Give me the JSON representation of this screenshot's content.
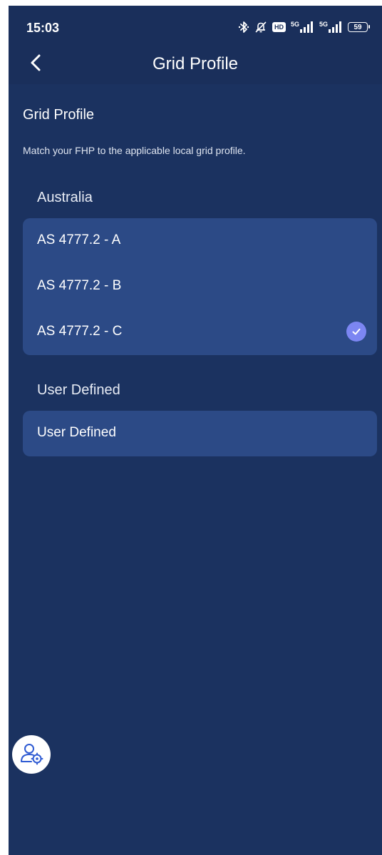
{
  "status_bar": {
    "time": "15:03",
    "hd_label": "HD",
    "signal1_label": "5G",
    "signal2_label": "5G",
    "battery": "59"
  },
  "header": {
    "title": "Grid Profile",
    "back_icon": "chevron-left-icon"
  },
  "content": {
    "heading": "Grid Profile",
    "description": "Match your FHP to the applicable local grid profile.",
    "groups": [
      {
        "label": "Australia",
        "options": [
          {
            "label": "AS 4777.2 - A",
            "selected": false
          },
          {
            "label": "AS 4777.2 - B",
            "selected": false
          },
          {
            "label": "AS 4777.2 - C",
            "selected": true
          }
        ]
      },
      {
        "label": "User Defined",
        "options": [
          {
            "label": "User Defined",
            "selected": false
          }
        ]
      }
    ]
  },
  "floating_button": {
    "icon": "user-settings-icon"
  },
  "colors": {
    "background": "#1b3260",
    "header": "#1a2f5b",
    "card": "#2c4a86",
    "check": "#7c86f2"
  }
}
